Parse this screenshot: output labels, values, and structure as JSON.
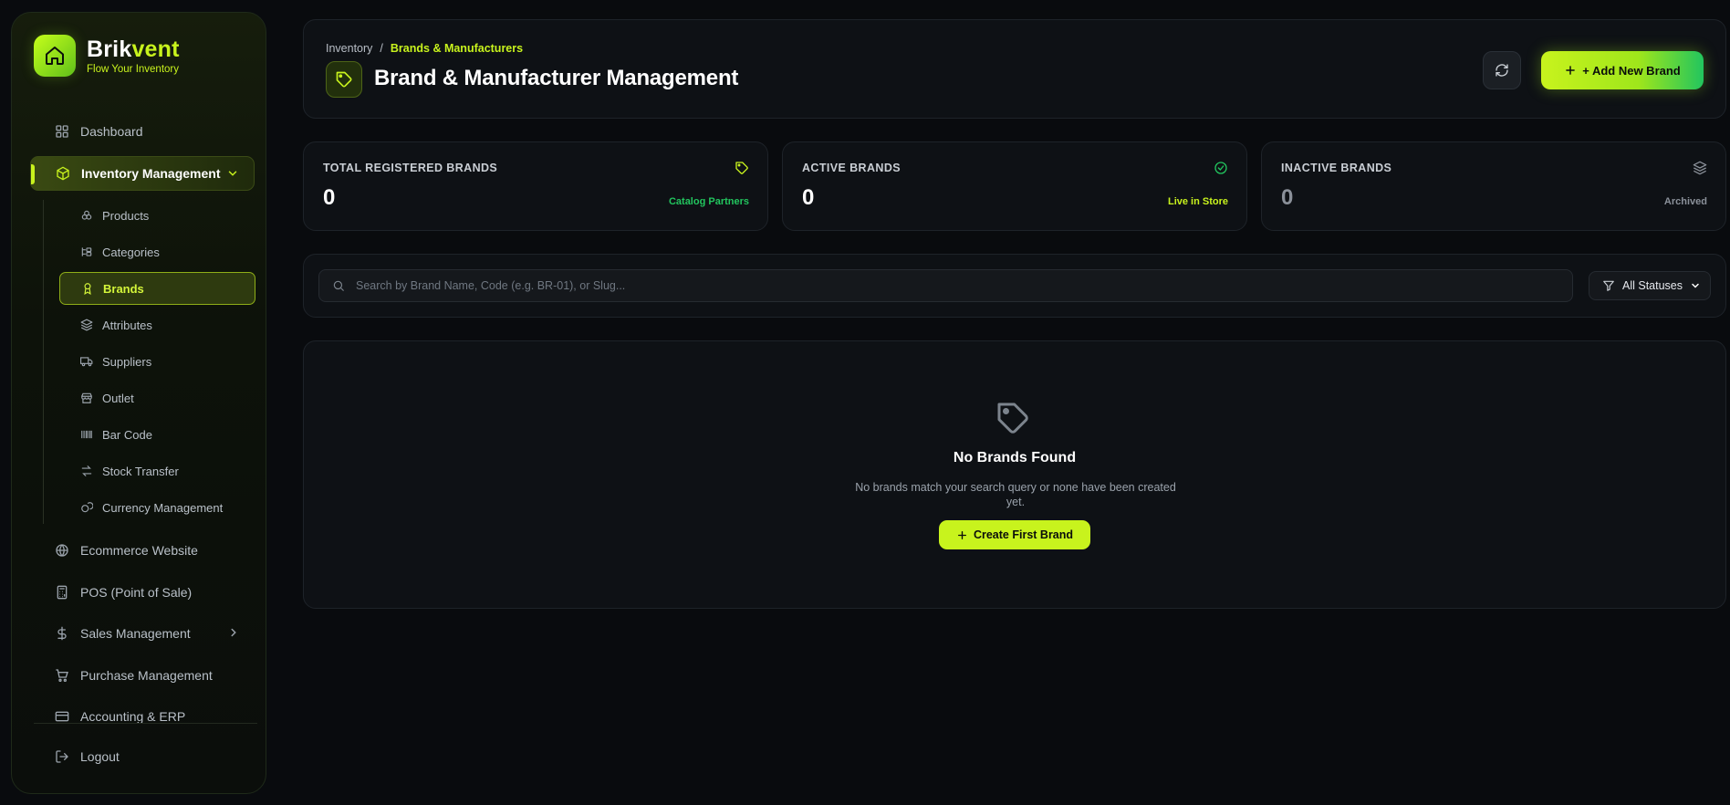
{
  "colors": {
    "accent": "#c8f31d",
    "accent_green": "#22c55e",
    "bg": "#090b0e"
  },
  "sidebar": {
    "brand_prefix": "Brik",
    "brand_suffix": "vent",
    "tagline": "Flow Your Inventory",
    "items": [
      {
        "label": "Dashboard",
        "icon": "grid-icon"
      },
      {
        "label": "Inventory Management",
        "icon": "box-icon"
      },
      {
        "label": "Ecommerce Website",
        "icon": "globe-icon"
      },
      {
        "label": "POS (Point of Sale)",
        "icon": "calculator-icon"
      },
      {
        "label": "Sales Management",
        "icon": "dollar-icon"
      },
      {
        "label": "Purchase Management",
        "icon": "cart-icon"
      },
      {
        "label": "Accounting & ERP",
        "icon": "card-icon"
      }
    ],
    "sub_items": [
      {
        "label": "Products",
        "icon": "products-icon"
      },
      {
        "label": "Categories",
        "icon": "categories-icon"
      },
      {
        "label": "Brands",
        "icon": "brand-badge-icon"
      },
      {
        "label": "Attributes",
        "icon": "layers-icon"
      },
      {
        "label": "Suppliers",
        "icon": "truck-icon"
      },
      {
        "label": "Outlet",
        "icon": "store-icon"
      },
      {
        "label": "Bar Code",
        "icon": "barcode-icon"
      },
      {
        "label": "Stock Transfer",
        "icon": "transfer-icon"
      },
      {
        "label": "Currency Management",
        "icon": "coins-icon"
      }
    ],
    "logout": "Logout"
  },
  "header": {
    "breadcrumb_root": "Inventory",
    "breadcrumb_sep": "/",
    "breadcrumb_current": "Brands & Manufacturers",
    "title": "Brand & Manufacturer Management",
    "add_label": "+ Add New Brand"
  },
  "stats": [
    {
      "label": "TOTAL REGISTERED BRANDS",
      "value": "0",
      "sub": "Catalog Partners",
      "sub_color": "#22c55e",
      "icon": "tag-icon"
    },
    {
      "label": "ACTIVE BRANDS",
      "value": "0",
      "sub": "Live in Store",
      "sub_color": "#c8f31d",
      "icon": "check-circle-icon"
    },
    {
      "label": "INACTIVE BRANDS",
      "value": "0",
      "sub": "Archived",
      "sub_color": "#8a9099",
      "icon": "layers-icon"
    }
  ],
  "search": {
    "placeholder": "Search by Brand Name, Code (e.g. BR-01), or Slug...",
    "status_filter": "All Statuses"
  },
  "empty": {
    "title": "No Brands Found",
    "description": "No brands match your search query or none have been created yet.",
    "button": "Create First Brand"
  }
}
